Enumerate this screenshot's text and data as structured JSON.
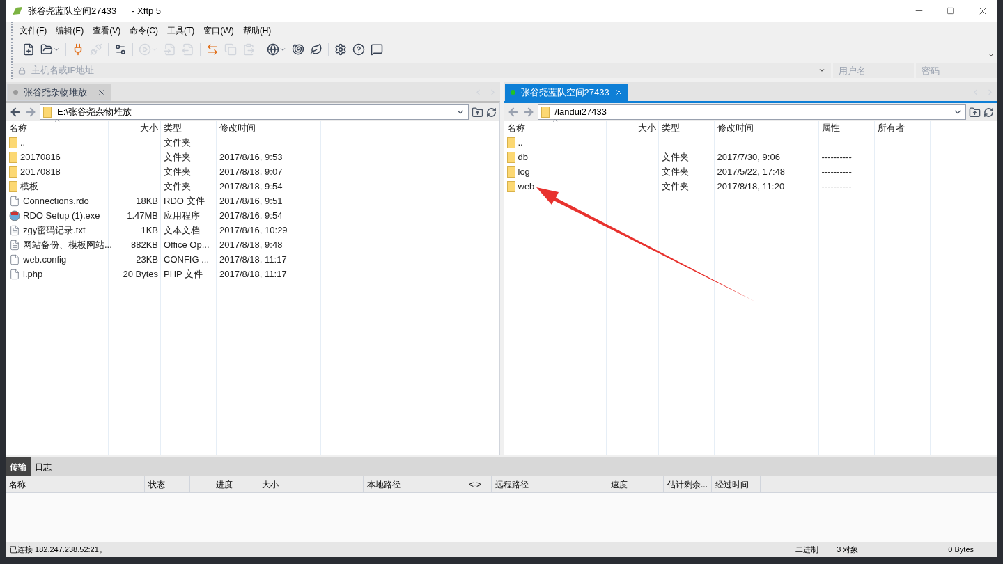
{
  "window": {
    "title": "张谷尧蓝队空间27433",
    "app": "- Xftp 5"
  },
  "menu": [
    "文件(F)",
    "编辑(E)",
    "查看(V)",
    "命令(C)",
    "工具(T)",
    "窗口(W)",
    "帮助(H)"
  ],
  "toolbar": [
    {
      "kind": "new",
      "disabled": false
    },
    {
      "kind": "open",
      "disabled": false
    },
    {
      "kind": "connect",
      "disabled": false
    },
    {
      "kind": "disconnect",
      "disabled": true
    },
    {
      "kind": "properties",
      "disabled": false
    },
    {
      "kind": "play",
      "disabled": true
    },
    {
      "kind": "upload",
      "disabled": true
    },
    {
      "kind": "download",
      "disabled": true
    },
    {
      "kind": "transfer",
      "disabled": false
    },
    {
      "kind": "copy",
      "disabled": true
    },
    {
      "kind": "paste",
      "disabled": true
    },
    {
      "kind": "globe",
      "disabled": false
    },
    {
      "kind": "shell",
      "disabled": false
    },
    {
      "kind": "leaf",
      "disabled": false
    },
    {
      "kind": "settings",
      "disabled": false
    },
    {
      "kind": "help",
      "disabled": false
    },
    {
      "kind": "chat",
      "disabled": false
    }
  ],
  "address": {
    "host_placeholder": "主机名或IP地址",
    "user_placeholder": "用户名",
    "password_placeholder": "密码"
  },
  "panes": [
    {
      "tab": {
        "label": "张谷尧杂物堆放",
        "selected": false,
        "connected": false
      },
      "path": "E:\\张谷尧杂物堆放",
      "columns": [
        "名称",
        "大小",
        "类型",
        "修改时间"
      ],
      "rows": [
        {
          "kind": "folder",
          "cells": [
            "..",
            "",
            "文件夹",
            ""
          ]
        },
        {
          "kind": "folder",
          "cells": [
            "20170816",
            "",
            "文件夹",
            "2017/8/16, 9:53"
          ]
        },
        {
          "kind": "folder",
          "cells": [
            "20170818",
            "",
            "文件夹",
            "2017/8/18, 9:07"
          ]
        },
        {
          "kind": "folder",
          "cells": [
            "模板",
            "",
            "文件夹",
            "2017/8/18, 9:54"
          ]
        },
        {
          "kind": "file",
          "cells": [
            "Connections.rdo",
            "18KB",
            "RDO 文件",
            "2017/8/16, 9:51"
          ]
        },
        {
          "kind": "app",
          "cells": [
            "RDO Setup (1).exe",
            "1.47MB",
            "应用程序",
            "2017/8/16, 9:54"
          ]
        },
        {
          "kind": "text",
          "cells": [
            "zgy密码记录.txt",
            "1KB",
            "文本文档",
            "2017/8/16, 10:29"
          ]
        },
        {
          "kind": "text",
          "cells": [
            "网站备份、模板网站...",
            "882KB",
            "Office Op...",
            "2017/8/18, 9:48"
          ]
        },
        {
          "kind": "file",
          "cells": [
            "web.config",
            "23KB",
            "CONFIG ...",
            "2017/8/18, 11:17"
          ]
        },
        {
          "kind": "file",
          "cells": [
            "i.php",
            "20 Bytes",
            "PHP 文件",
            "2017/8/18, 11:17"
          ]
        }
      ]
    },
    {
      "tab": {
        "label": "张谷尧蓝队空间27433",
        "selected": true,
        "connected": true
      },
      "path": "/landui27433",
      "columns": [
        "名称",
        "大小",
        "类型",
        "修改时间",
        "属性",
        "所有者"
      ],
      "rows": [
        {
          "kind": "folder",
          "cells": [
            "..",
            "",
            "",
            "",
            "",
            ""
          ]
        },
        {
          "kind": "folder",
          "cells": [
            "db",
            "",
            "文件夹",
            "2017/7/30, 9:06",
            "----------",
            ""
          ]
        },
        {
          "kind": "folder",
          "cells": [
            "log",
            "",
            "文件夹",
            "2017/5/22, 17:48",
            "----------",
            ""
          ]
        },
        {
          "kind": "folder",
          "cells": [
            "web",
            "",
            "文件夹",
            "2017/8/18, 11:20",
            "----------",
            ""
          ]
        }
      ]
    }
  ],
  "transfer": {
    "tabs": [
      {
        "label": "传输",
        "selected": true
      },
      {
        "label": "日志",
        "selected": false
      }
    ],
    "columns": [
      "名称",
      "状态",
      "进度",
      "大小",
      "本地路径",
      "<->",
      "远程路径",
      "速度",
      "估计剩余...",
      "经过时间"
    ]
  },
  "status": {
    "connection": "已连接 182.247.238.52:21。",
    "mode": "二进制",
    "objects": "3 对象",
    "size": "0 Bytes"
  }
}
